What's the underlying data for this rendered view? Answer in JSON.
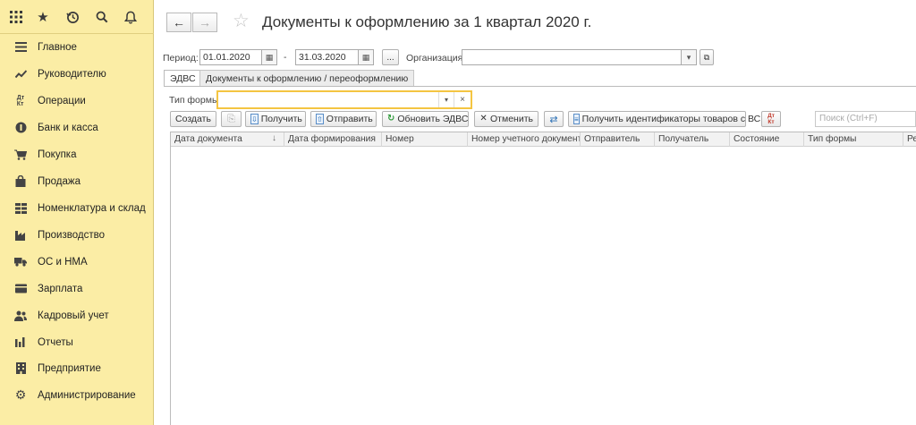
{
  "sidebar": {
    "top_icons": [
      "apps-grid-icon",
      "star-icon",
      "history-icon",
      "search-icon",
      "bell-icon"
    ],
    "items": [
      {
        "label": "Главное",
        "icon": "menu-lines-icon"
      },
      {
        "label": "Руководителю",
        "icon": "trend-chart-icon"
      },
      {
        "label": "Операции",
        "icon": "debit-credit-icon"
      },
      {
        "label": "Банк и касса",
        "icon": "coin-icon"
      },
      {
        "label": "Покупка",
        "icon": "cart-icon"
      },
      {
        "label": "Продажа",
        "icon": "shopping-bag-icon"
      },
      {
        "label": "Номенклатура и склад",
        "icon": "grid-blocks-icon"
      },
      {
        "label": "Производство",
        "icon": "factory-icon"
      },
      {
        "label": "ОС и НМА",
        "icon": "truck-icon"
      },
      {
        "label": "Зарплата",
        "icon": "wallet-icon"
      },
      {
        "label": "Кадровый учет",
        "icon": "people-icon"
      },
      {
        "label": "Отчеты",
        "icon": "bar-chart-icon"
      },
      {
        "label": "Предприятие",
        "icon": "building-icon"
      },
      {
        "label": "Администрирование",
        "icon": "gear-icon"
      }
    ]
  },
  "header": {
    "title": "Документы к оформлению  за 1 квартал 2020 г."
  },
  "filters": {
    "period_label": "Период:",
    "date_from": "01.01.2020",
    "dash": "-",
    "date_to": "31.03.2020",
    "ellipsis": "...",
    "org_label": "Организация:",
    "org_value": ""
  },
  "tabs": [
    {
      "label": "ЭДВС",
      "active": true
    },
    {
      "label": "Документы к оформлению / переоформлению",
      "active": false
    }
  ],
  "form_type": {
    "label": "Тип формы:",
    "value": ""
  },
  "toolbar": {
    "create": "Создать",
    "receive": "Получить",
    "send": "Отправить",
    "refresh": "Обновить ЭДВС",
    "cancel": "Отменить",
    "get_ids": "Получить идентификаторы товаров с ВС",
    "debit_credit": "Дт Кт",
    "search_placeholder": "Поиск (Ctrl+F)"
  },
  "table": {
    "columns": [
      "Дата документа",
      "Дата формирования",
      "Номер",
      "Номер учетного документа",
      "Отправитель",
      "Получатель",
      "Состояние",
      "Тип формы",
      "Ре"
    ],
    "rows": []
  }
}
